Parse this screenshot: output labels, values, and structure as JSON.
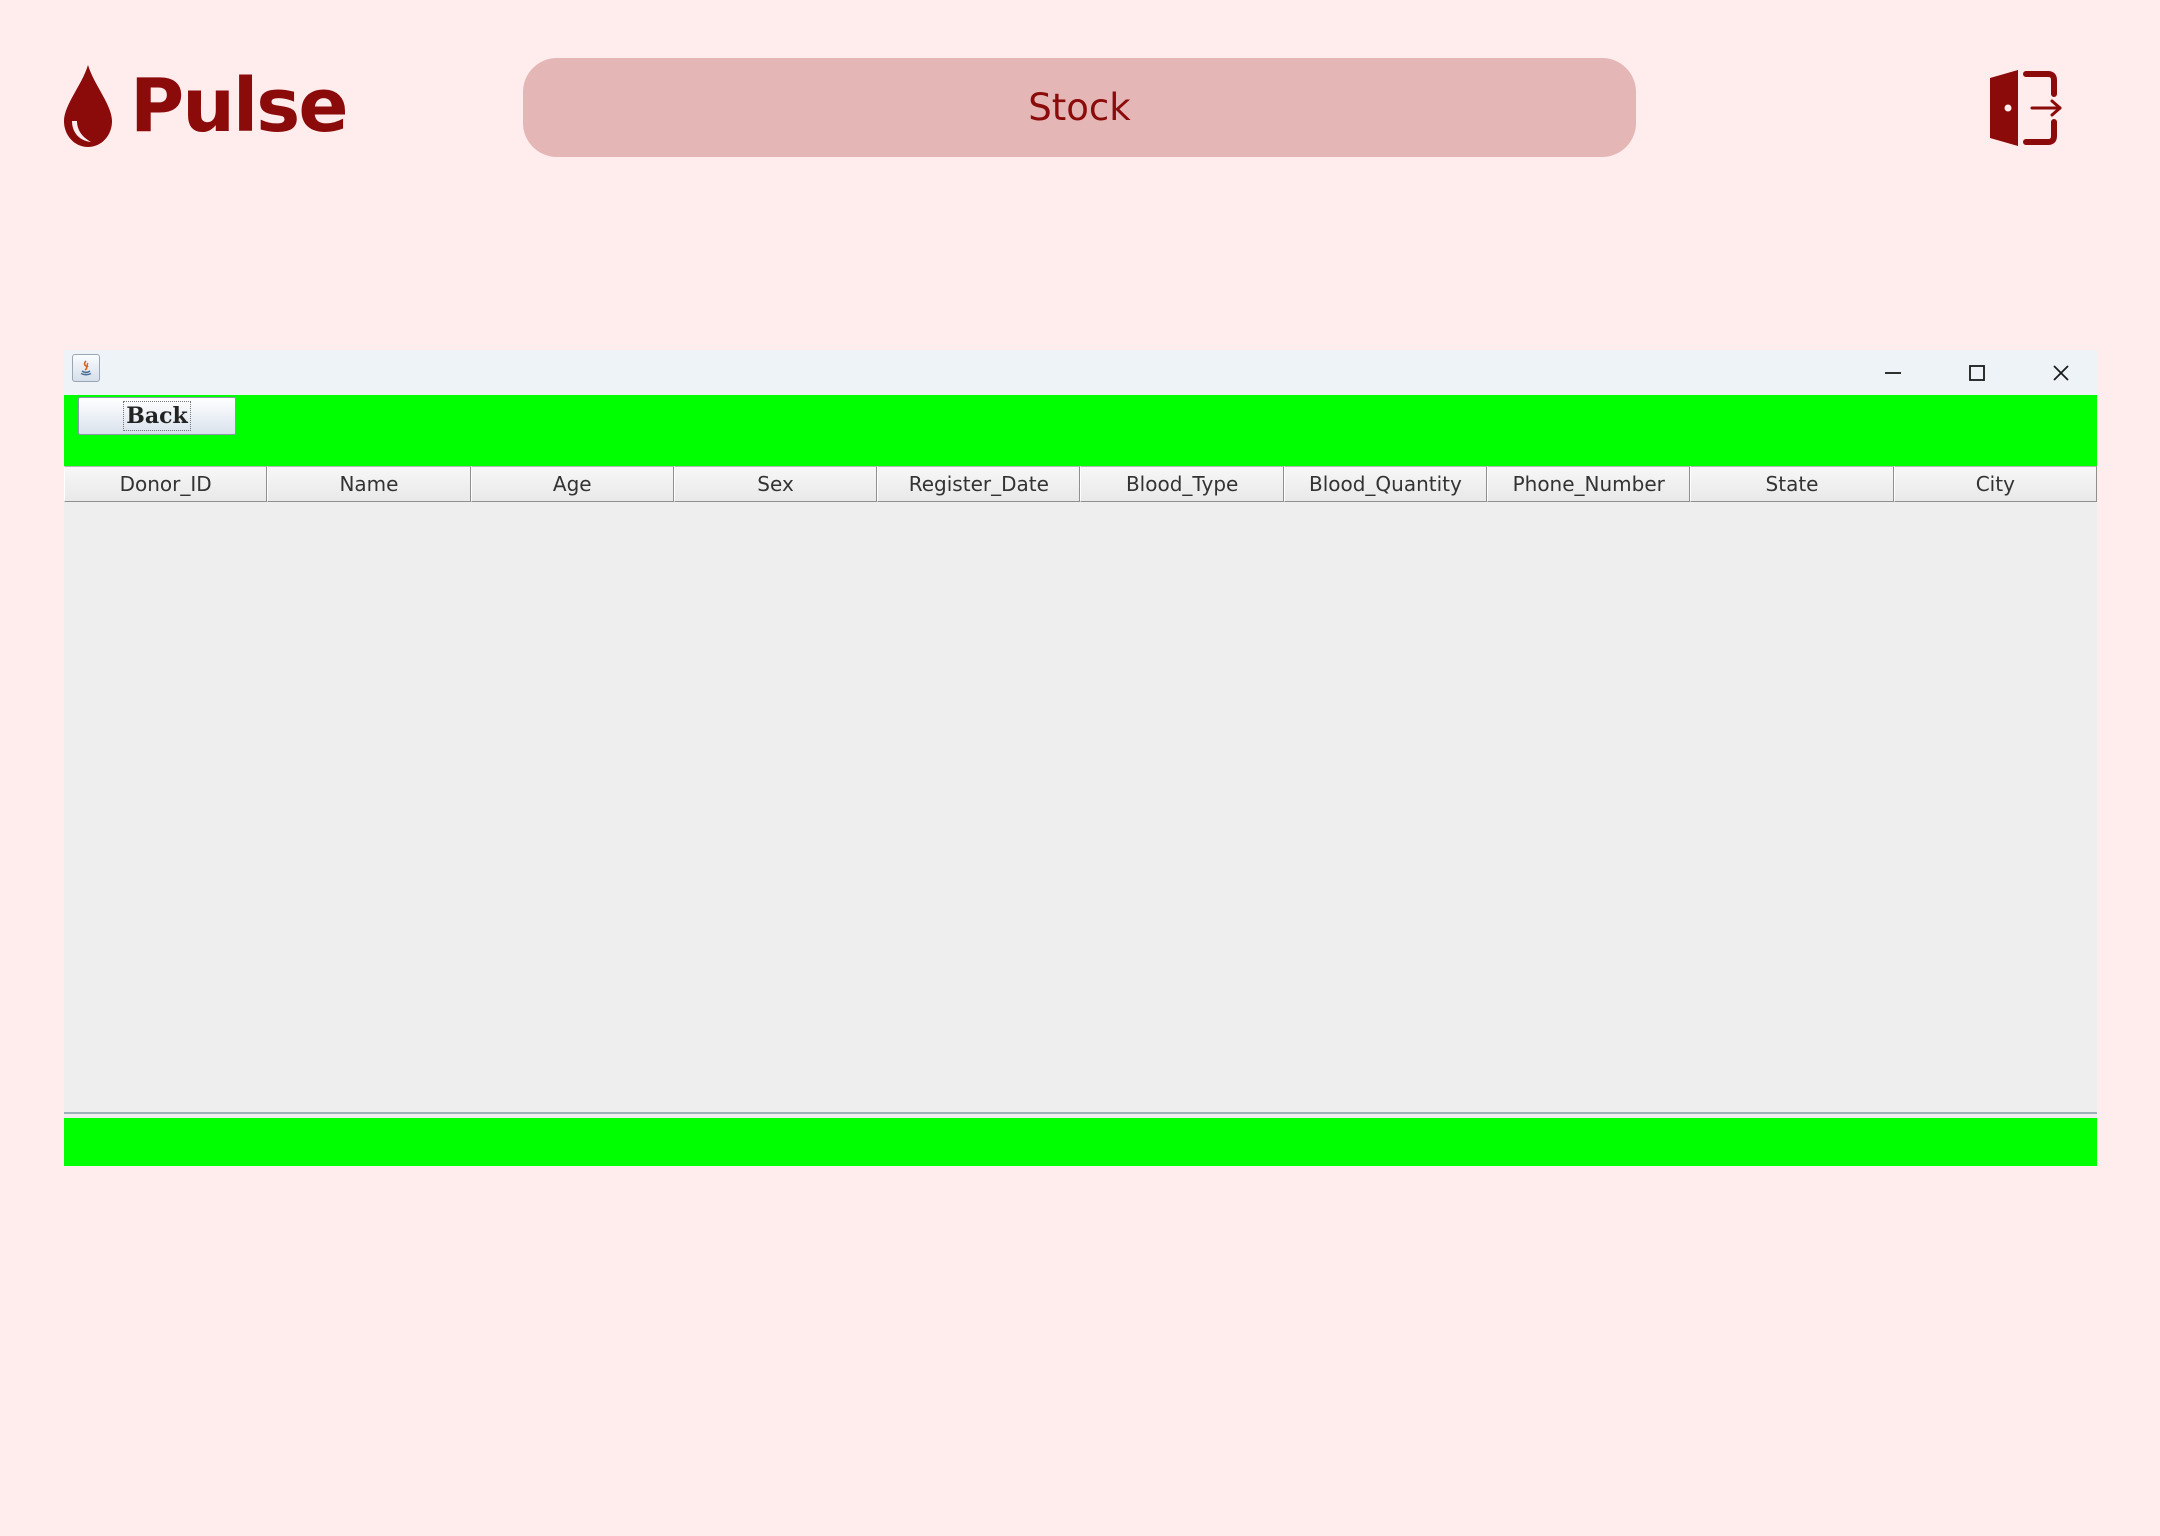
{
  "app": {
    "brand": "Pulse",
    "page_title": "Stock",
    "logout_icon": "logout-door-icon",
    "brand_icon": "blood-drop-icon"
  },
  "window": {
    "icon": "java-app-icon",
    "controls": [
      "minimize",
      "maximize",
      "close"
    ]
  },
  "toolbar": {
    "back_label": "Back"
  },
  "table": {
    "columns": [
      "Donor_ID",
      "Name",
      "Age",
      "Sex",
      "Register_Date",
      "Blood_Type",
      "Blood_Quantity",
      "Phone_Number",
      "State",
      "City"
    ],
    "rows": []
  },
  "colors": {
    "background": "#ffecec",
    "brand": "#8b0a0a",
    "pill": "#e4b6b6",
    "accent_bar": "#00ff00",
    "table_bg": "#eeeeee"
  }
}
